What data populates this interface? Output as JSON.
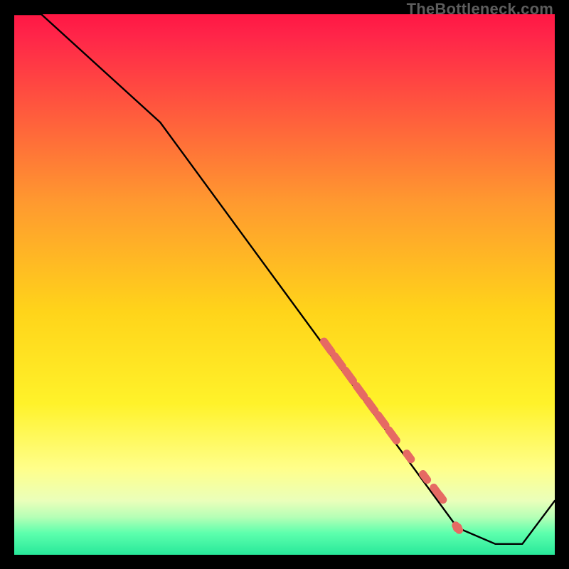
{
  "watermark": "TheBottleneck.com",
  "chart_data": {
    "type": "line",
    "title": "",
    "xlabel": "",
    "ylabel": "",
    "xlim": [
      0,
      100
    ],
    "ylim": [
      0,
      100
    ],
    "grid": false,
    "legend": false,
    "line": {
      "x": [
        0,
        5,
        27,
        82,
        89,
        94,
        100
      ],
      "y": [
        100,
        100,
        80,
        5,
        2,
        2,
        10
      ]
    },
    "highlight_points": {
      "comment": "salmon / coral colored marker cluster along the descending segment",
      "x": [
        58,
        60,
        62,
        64,
        66,
        68,
        70,
        73,
        76,
        78,
        79,
        82
      ],
      "y": [
        38.5,
        35.8,
        33.1,
        30.3,
        27.6,
        24.9,
        22.1,
        18.2,
        14.4,
        11.9,
        10.6,
        5.0
      ]
    },
    "background_gradient": {
      "direction": "vertical-top-to-bottom",
      "stops": [
        {
          "offset": 0.0,
          "color": "#ff1744"
        },
        {
          "offset": 0.04,
          "color": "#ff2549"
        },
        {
          "offset": 0.35,
          "color": "#ff9a2f"
        },
        {
          "offset": 0.55,
          "color": "#ffd41a"
        },
        {
          "offset": 0.72,
          "color": "#fff22a"
        },
        {
          "offset": 0.84,
          "color": "#ffff8a"
        },
        {
          "offset": 0.9,
          "color": "#eaffba"
        },
        {
          "offset": 0.93,
          "color": "#b6ffb6"
        },
        {
          "offset": 0.96,
          "color": "#5dffad"
        },
        {
          "offset": 1.0,
          "color": "#28e89a"
        }
      ]
    }
  }
}
